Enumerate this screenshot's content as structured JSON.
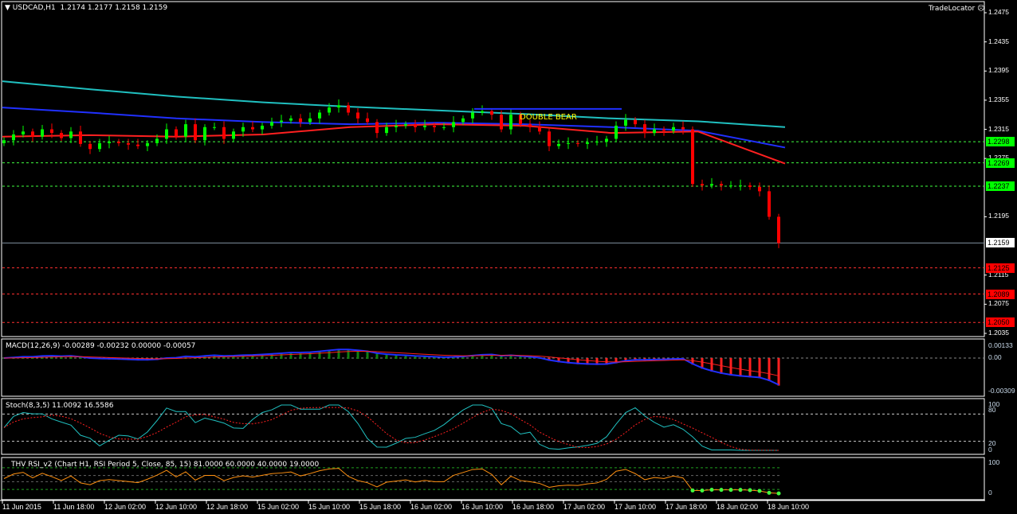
{
  "header": {
    "symbol": "USDCAD,H1",
    "ohlc": "1.2174 1.2177 1.2158 1.2159",
    "brand": "TradeLocator"
  },
  "price_axis": [
    "1.2475",
    "1.2435",
    "1.2395",
    "1.2355",
    "1.2315",
    "1.2275",
    "1.2195",
    "1.2115",
    "1.2075",
    "1.2035"
  ],
  "levels": {
    "support_green": [
      "1.2298",
      "1.2269",
      "1.2237"
    ],
    "current": "1.2159",
    "resistance_red": [
      "1.2125",
      "1.2089",
      "1.2050"
    ]
  },
  "annotation": "DOUBLE  BEAR",
  "macd": {
    "label": "MACD(12,26,9) -0.00289 -0.00232 0.00000 -0.00057",
    "axis": [
      "0.00133",
      "0.00",
      "-0.00309"
    ]
  },
  "stoch": {
    "label": "Stoch(8,3,5) 11.0092 16.5586",
    "axis": [
      "100",
      "80",
      "20",
      "0"
    ]
  },
  "rsi": {
    "label": "THV RSI_v2   (Chart H1,  RSI Period 5,  Close,  85,  15)   81.0000 60.0000 40.0000 19.0000",
    "axis": [
      "100",
      "0"
    ]
  },
  "time_axis": [
    "11 Jun 2015",
    "11 Jun 18:00",
    "12 Jun 02:00",
    "12 Jun 10:00",
    "12 Jun 18:00",
    "15 Jun 02:00",
    "15 Jun 10:00",
    "15 Jun 18:00",
    "16 Jun 02:00",
    "16 Jun 10:00",
    "16 Jun 18:00",
    "17 Jun 02:00",
    "17 Jun 10:00",
    "17 Jun 18:00",
    "18 Jun 02:00",
    "18 Jun 10:00"
  ],
  "colors": {
    "bull": "#00ff00",
    "bear": "#ff0000",
    "ma_slow": "#20c0c0",
    "ma_mid": "#2030ff",
    "ma_fast": "#ff2020"
  },
  "chart_data": {
    "type": "candlestick",
    "closes": [
      1.23,
      1.2308,
      1.2312,
      1.2305,
      1.2315,
      1.231,
      1.2303,
      1.2312,
      1.2295,
      1.2288,
      1.2296,
      1.2298,
      1.2296,
      1.2294,
      1.2292,
      1.2296,
      1.2302,
      1.2315,
      1.2305,
      1.2322,
      1.23,
      1.2318,
      1.2318,
      1.2302,
      1.2312,
      1.2318,
      1.2315,
      1.232,
      1.2325,
      1.2327,
      1.233,
      1.2325,
      1.233,
      1.2338,
      1.2345,
      1.2348,
      1.2338,
      1.233,
      1.2325,
      1.231,
      1.2318,
      1.232,
      1.2322,
      1.2318,
      1.232,
      1.2318,
      1.2318,
      1.2325,
      1.233,
      1.2338,
      1.234,
      1.2335,
      1.2315,
      1.2335,
      1.2322,
      1.2318,
      1.2312,
      1.2292,
      1.2295,
      1.2296,
      1.2295,
      1.2297,
      1.2298,
      1.2302,
      1.232,
      1.2328,
      1.2322,
      1.231,
      1.2315,
      1.2313,
      1.2318,
      1.2315,
      1.224,
      1.2238,
      1.224,
      1.2238,
      1.2238,
      1.2238,
      1.2236,
      1.223,
      1.2195,
      1.2159
    ],
    "ma_slow": [
      1.2381,
      1.237,
      1.236,
      1.2352,
      1.2346,
      1.2341,
      1.2336,
      1.233,
      1.2326,
      1.2318
    ],
    "ma_mid": [
      1.2345,
      1.2338,
      1.233,
      1.2325,
      1.2322,
      1.2324,
      1.2322,
      1.2318,
      1.2313,
      1.229
    ],
    "ma_fast": [
      1.2305,
      1.2307,
      1.2305,
      1.2308,
      1.2318,
      1.2322,
      1.232,
      1.231,
      1.2312,
      1.2268
    ],
    "ylim": [
      1.2035,
      1.2475
    ]
  }
}
